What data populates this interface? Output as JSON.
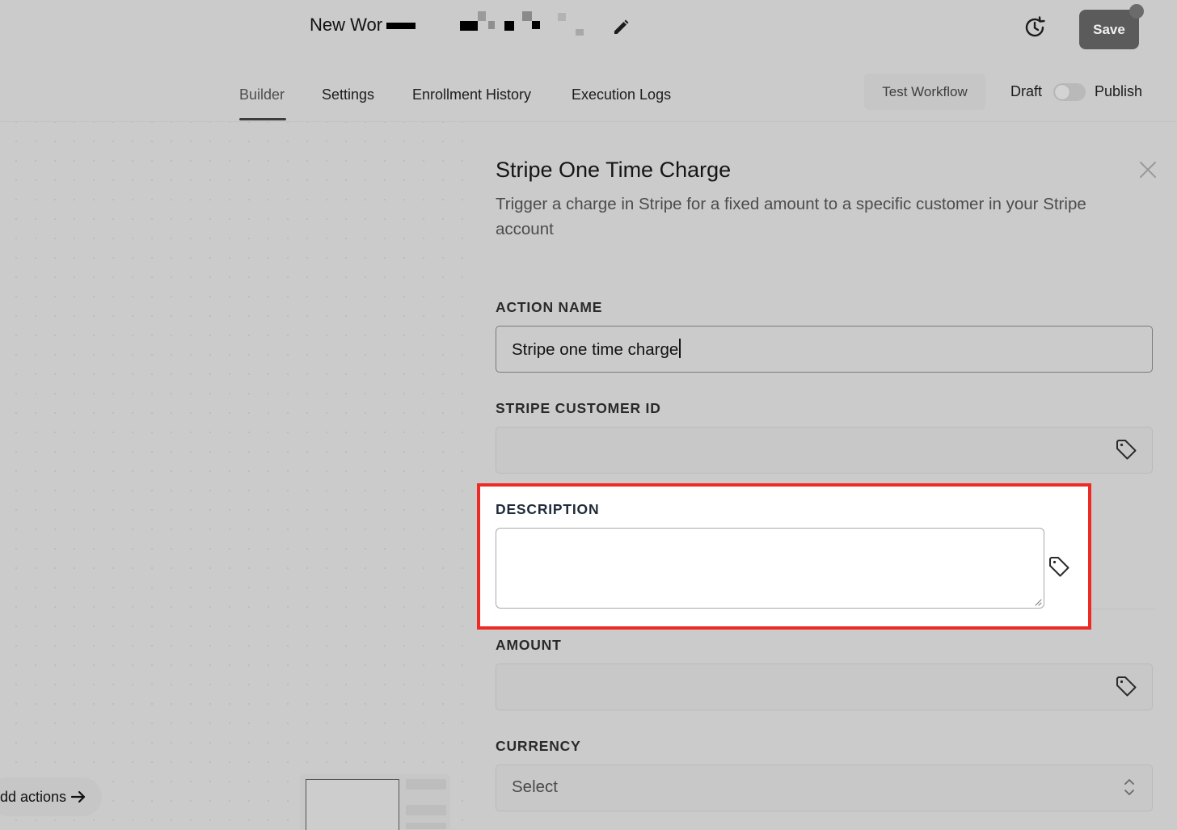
{
  "header": {
    "workflow_title": "New Wor",
    "save_label": "Save"
  },
  "tabs": [
    {
      "label": "Builder",
      "active": true
    },
    {
      "label": "Settings",
      "active": false
    },
    {
      "label": "Enrollment History",
      "active": false
    },
    {
      "label": "Execution Logs",
      "active": false
    }
  ],
  "toolbar": {
    "test_label": "Test Workflow",
    "draft_label": "Draft",
    "publish_label": "Publish",
    "published": false
  },
  "canvas": {
    "add_actions_label": "dd actions"
  },
  "panel": {
    "title": "Stripe One Time Charge",
    "description": "Trigger a charge in Stripe for a fixed amount to a specific customer in your Stripe account",
    "fields": {
      "action_name": {
        "label": "ACTION NAME",
        "value": "Stripe one time charge"
      },
      "customer_id": {
        "label": "STRIPE CUSTOMER ID",
        "value": ""
      },
      "description": {
        "label": "DESCRIPTION",
        "value": ""
      },
      "amount": {
        "label": "AMOUNT",
        "value": ""
      },
      "currency": {
        "label": "CURRENCY",
        "value": "Select"
      }
    }
  },
  "icons": [
    "edit-icon",
    "history-icon",
    "close-icon",
    "tag-icon",
    "arrow-right-icon",
    "chevron-updown-icon",
    "resize-handle-icon"
  ],
  "colors": {
    "highlight": "#ee2a24",
    "save_button": "#5b5b5b"
  }
}
